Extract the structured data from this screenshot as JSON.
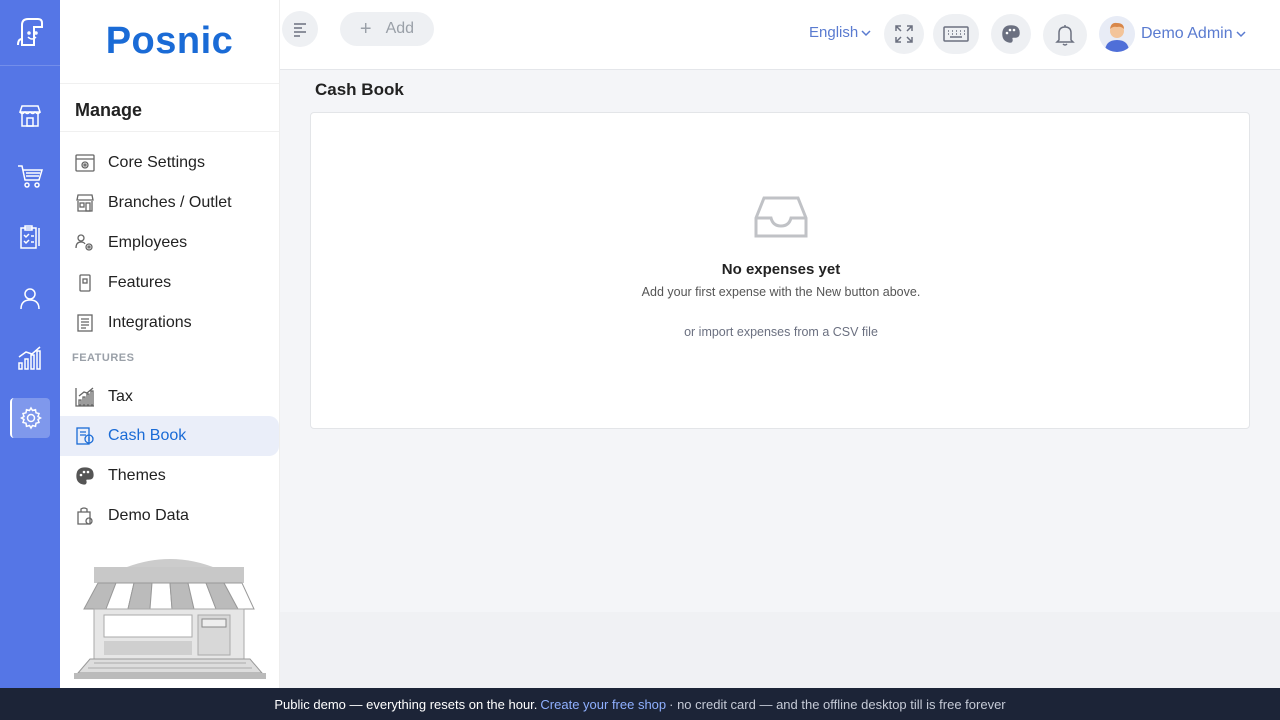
{
  "app": {
    "brand": "Posnic"
  },
  "rail": {
    "items": [
      {
        "icon": "store-icon"
      },
      {
        "icon": "cart-icon"
      },
      {
        "icon": "clipboard-icon"
      },
      {
        "icon": "user-icon"
      },
      {
        "icon": "analytics-icon"
      },
      {
        "icon": "settings-icon",
        "active": true
      }
    ]
  },
  "sidebar": {
    "title": "Manage",
    "section_label": "FEATURES",
    "items": [
      {
        "label": "Core Settings",
        "icon": "core-settings-icon"
      },
      {
        "label": "Branches / Outlet",
        "icon": "branches-icon"
      },
      {
        "label": "Employees",
        "icon": "employees-icon"
      },
      {
        "label": "Features",
        "icon": "features-icon"
      },
      {
        "label": "Integrations",
        "icon": "integrations-icon"
      },
      {
        "label": "Tax",
        "icon": "tax-icon"
      },
      {
        "label": "Cash Book",
        "icon": "cash-book-icon",
        "active": true
      },
      {
        "label": "Themes",
        "icon": "palette-icon"
      },
      {
        "label": "Demo Data",
        "icon": "demo-data-icon"
      }
    ]
  },
  "header": {
    "add_label": "Add",
    "language": "English",
    "user_name": "Demo Admin"
  },
  "main": {
    "title": "Cash Book",
    "empty_title": "No expenses yet",
    "empty_subtitle": "Add your first expense with the New button above.",
    "empty_csv": "or import expenses from a CSV file"
  },
  "banner": {
    "text": "Public demo — everything resets on the hour.",
    "link": "Create your free shop",
    "rest": "· no credit card — and the offline desktop till is free forever"
  },
  "colors": {
    "accent": "#5576e6",
    "brand": "#1a6bd6",
    "banner": "#1c2437"
  }
}
